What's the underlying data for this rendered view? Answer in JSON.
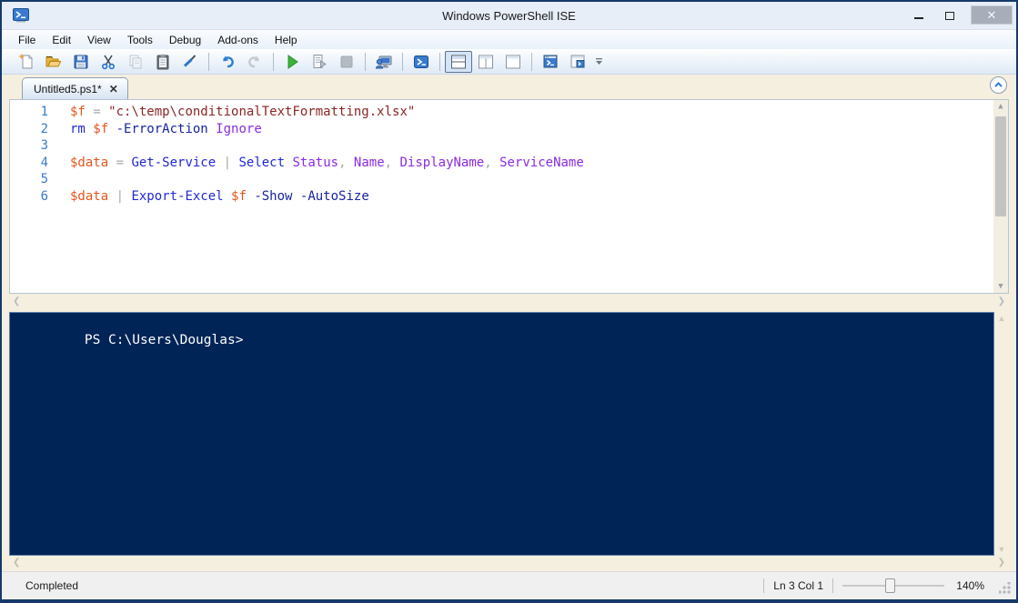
{
  "window": {
    "title": "Windows PowerShell ISE",
    "controls": {
      "minimize": "",
      "maximize": "",
      "close": "✕"
    }
  },
  "menu": {
    "items": [
      "File",
      "Edit",
      "View",
      "Tools",
      "Debug",
      "Add-ons",
      "Help"
    ]
  },
  "toolbar": {
    "buttons": [
      {
        "name": "new-script",
        "title": "New"
      },
      {
        "name": "open-script",
        "title": "Open"
      },
      {
        "name": "save-script",
        "title": "Save"
      },
      {
        "name": "cut",
        "title": "Cut"
      },
      {
        "name": "copy",
        "title": "Copy"
      },
      {
        "name": "paste",
        "title": "Paste"
      },
      {
        "name": "clear-console-pane",
        "title": "Clear Console Pane"
      },
      {
        "name": "undo",
        "title": "Undo"
      },
      {
        "name": "redo",
        "title": "Redo"
      },
      {
        "name": "run-script",
        "title": "Run Script (F5)"
      },
      {
        "name": "run-selection",
        "title": "Run Selection (F8)"
      },
      {
        "name": "stop-operation",
        "title": "Stop Operation (Ctrl+Break)"
      },
      {
        "name": "new-remote-powershell-tab",
        "title": "New Remote PowerShell Tab"
      },
      {
        "name": "start-powershell",
        "title": "Start PowerShell.exe"
      },
      {
        "name": "show-script-pane-top",
        "title": "Show Script Pane Top"
      },
      {
        "name": "show-script-pane-right",
        "title": "Show Script Pane Right"
      },
      {
        "name": "show-script-pane-maximized",
        "title": "Show Script Pane Maximized"
      },
      {
        "name": "new-powershell-tab",
        "title": "New PowerShell Tab"
      },
      {
        "name": "show-command-window",
        "title": "Show Command Window"
      }
    ]
  },
  "tab": {
    "label": "Untitled5.ps1*",
    "close_icon": "✕"
  },
  "editor": {
    "lines": [
      {
        "n": "1",
        "tokens": [
          [
            "v",
            "$f"
          ],
          [
            "o",
            " = "
          ],
          [
            "s",
            "\"c:\\temp\\conditionalTextFormatting.xlsx\""
          ]
        ]
      },
      {
        "n": "2",
        "tokens": [
          [
            "c",
            "rm "
          ],
          [
            "v",
            "$f "
          ],
          [
            "m",
            "-ErrorAction "
          ],
          [
            "a",
            "Ignore"
          ]
        ]
      },
      {
        "n": "3",
        "tokens": []
      },
      {
        "n": "4",
        "tokens": [
          [
            "v",
            "$data"
          ],
          [
            "o",
            " = "
          ],
          [
            "c",
            "Get-Service "
          ],
          [
            "o",
            "| "
          ],
          [
            "c",
            "Select "
          ],
          [
            "a",
            "Status"
          ],
          [
            "o",
            ", "
          ],
          [
            "a",
            "Name"
          ],
          [
            "o",
            ", "
          ],
          [
            "a",
            "DisplayName"
          ],
          [
            "o",
            ", "
          ],
          [
            "a",
            "ServiceName"
          ]
        ]
      },
      {
        "n": "5",
        "tokens": []
      },
      {
        "n": "6",
        "tokens": [
          [
            "v",
            "$data "
          ],
          [
            "o",
            "| "
          ],
          [
            "c",
            "Export-Excel "
          ],
          [
            "v",
            "$f "
          ],
          [
            "m",
            "-Show -AutoSize"
          ]
        ]
      }
    ]
  },
  "console": {
    "prompt": "PS C:\\Users\\Douglas>"
  },
  "statusbar": {
    "state": "Completed",
    "position": "Ln 3  Col 1",
    "zoom": "140%"
  },
  "colors": {
    "console_bg": "#012456",
    "variable": "#e2571f",
    "string": "#8b2525",
    "command": "#2028d6",
    "parameter": "#16259e",
    "argument": "#8a2be2",
    "operator": "#a9a9a9",
    "accent_blue": "#2f78c8"
  }
}
